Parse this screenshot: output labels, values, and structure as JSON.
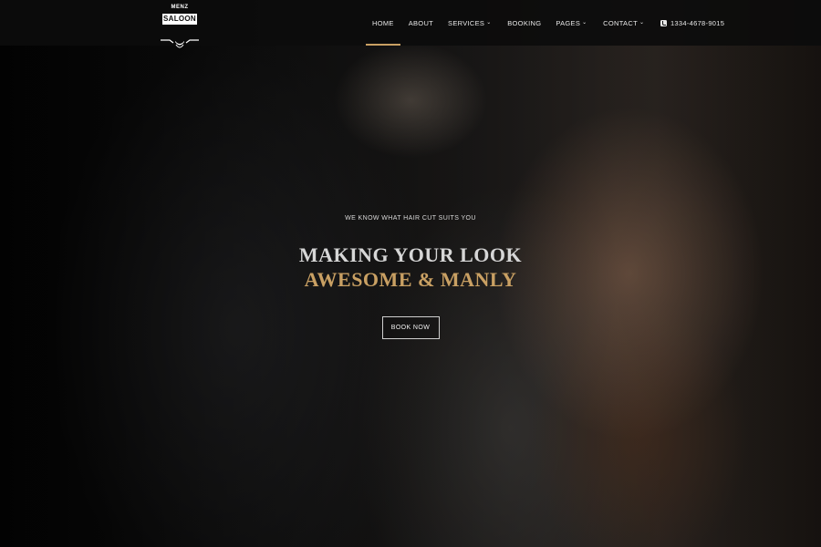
{
  "brand": {
    "top_text": "MENZ",
    "main_text": "SALOON"
  },
  "nav": {
    "items": [
      {
        "label": "HOME",
        "active": true,
        "dropdown": false
      },
      {
        "label": "ABOUT",
        "active": false,
        "dropdown": false
      },
      {
        "label": "SERVICES",
        "active": false,
        "dropdown": true
      },
      {
        "label": "BOOKING",
        "active": false,
        "dropdown": false
      },
      {
        "label": "PAGES",
        "active": false,
        "dropdown": true
      },
      {
        "label": "CONTACT",
        "active": false,
        "dropdown": true
      }
    ],
    "phone": "1334-4678-9015",
    "phone_icon": "phone-icon",
    "dropdown_icon": "chevron-down-icon"
  },
  "hero": {
    "tagline": "WE KNOW WHAT HAIR CUT SUITS YOU",
    "headline_line1": "MAKING YOUR LOOK",
    "headline_line2": "AWESOME & MANLY",
    "cta_label": "BOOK NOW"
  },
  "colors": {
    "accent": "#c9a063",
    "navbar_bg": "#0c0c0c",
    "text_light": "#e8e8e8"
  }
}
